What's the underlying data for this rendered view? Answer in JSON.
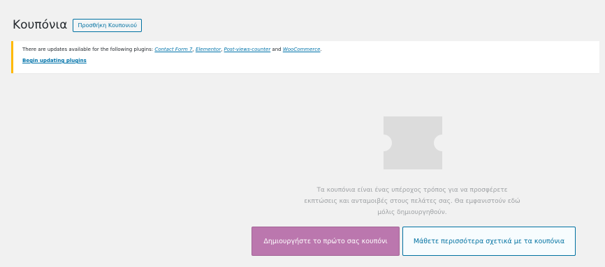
{
  "header": {
    "title": "Κουπόνια",
    "add_button": "Προσθήκη Κουπονιού"
  },
  "notice": {
    "intro": "There are updates available for the following plugins: ",
    "plugins": [
      "Contact Form 7",
      "Elementor",
      "Post-views-counter",
      "WooCommerce"
    ],
    "sep": ", ",
    "and": " and ",
    "end": ".",
    "action_link": "Begin updating plugins"
  },
  "empty_state": {
    "icon": "coupon-ticket-icon",
    "text_lines": [
      "Τα κουπόνια είναι ένας υπέροχος τρόπος για να προσφέρετε",
      "εκπτώσεις και ανταμοιβές στους πελάτες σας. Θα εμφανιστούν εδώ",
      "μόλις δημιουργηθούν."
    ],
    "primary_button": "Δημιουργήστε το πρώτο σας κουπόνι",
    "secondary_button": "Μάθετε περισσότερα σχετικά με τα κουπόνια"
  },
  "colors": {
    "notice_border": "#ffb900",
    "primary": "#bb77ae",
    "link": "#0073aa",
    "icon": "#dcdcdc"
  }
}
